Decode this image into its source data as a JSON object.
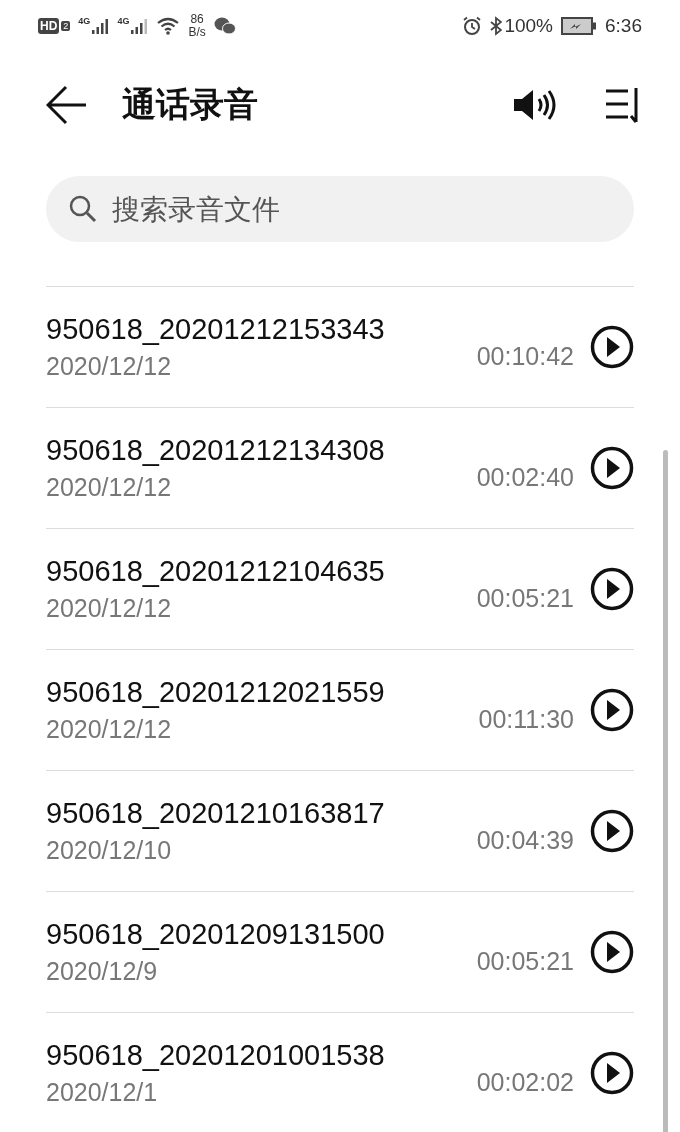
{
  "status_bar": {
    "hd": "HD",
    "sim": "2",
    "network_1": "4G",
    "network_2": "4G",
    "speed": "86",
    "speed_unit": "B/s",
    "battery": "100%",
    "time": "6:36"
  },
  "header": {
    "title": "通话录音"
  },
  "search": {
    "placeholder": "搜索录音文件"
  },
  "recordings": [
    {
      "name": "950618_20201212153343",
      "date": "2020/12/12",
      "duration": "00:10:42"
    },
    {
      "name": "950618_20201212134308",
      "date": "2020/12/12",
      "duration": "00:02:40"
    },
    {
      "name": "950618_20201212104635",
      "date": "2020/12/12",
      "duration": "00:05:21"
    },
    {
      "name": "950618_20201212021559",
      "date": "2020/12/12",
      "duration": "00:11:30"
    },
    {
      "name": "950618_20201210163817",
      "date": "2020/12/10",
      "duration": "00:04:39"
    },
    {
      "name": "950618_20201209131500",
      "date": "2020/12/9",
      "duration": "00:05:21"
    },
    {
      "name": "950618_20201201001538",
      "date": "2020/12/1",
      "duration": "00:02:02"
    }
  ]
}
